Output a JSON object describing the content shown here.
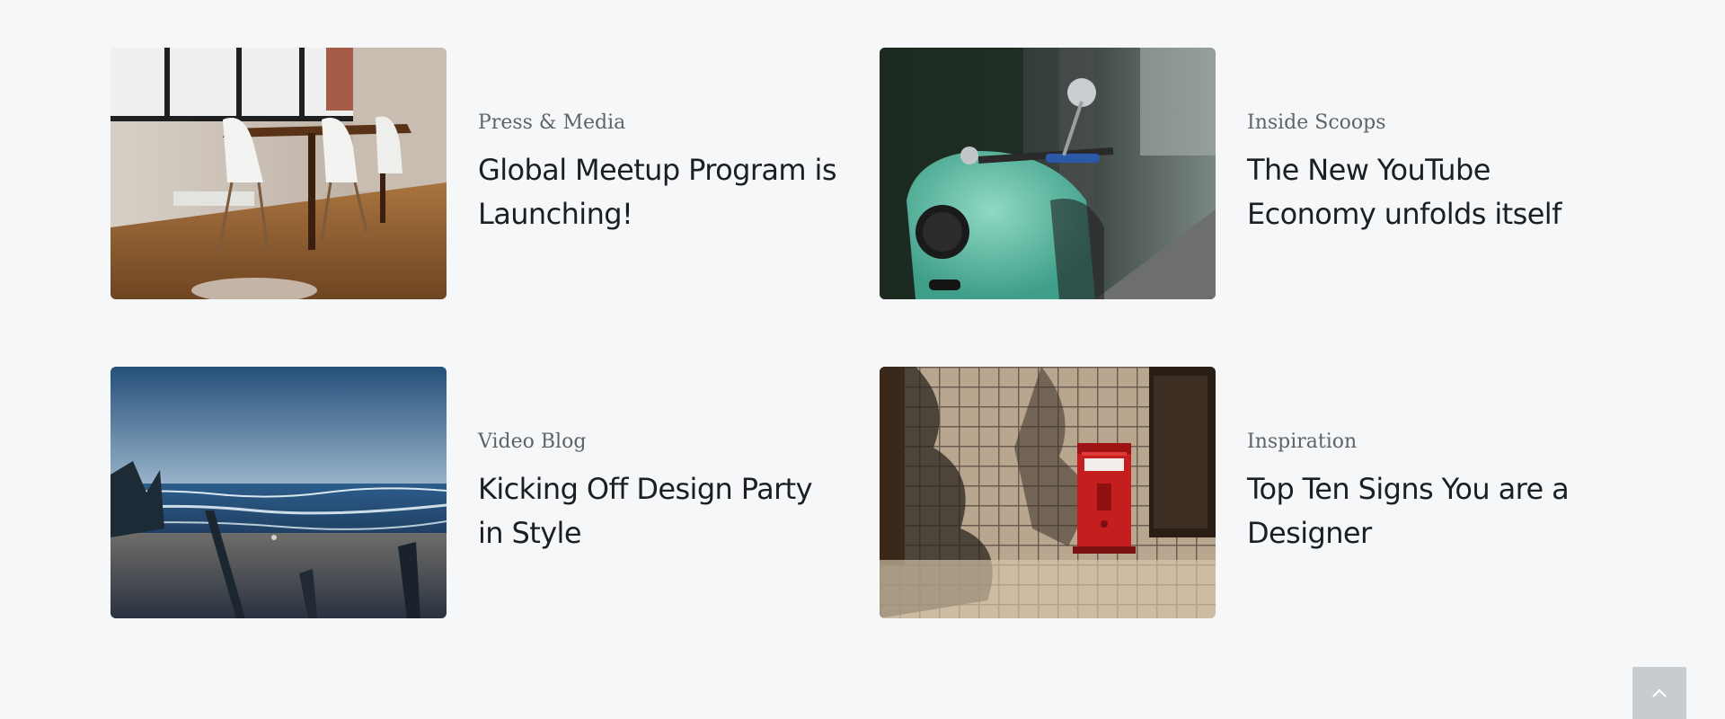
{
  "posts": [
    {
      "category": "Press & Media",
      "title": "Global Meetup Program is Launching!",
      "image_icon": "dining-room-image"
    },
    {
      "category": "Inside Scoops",
      "title": "The New YouTube Economy unfolds itself",
      "image_icon": "scooter-image"
    },
    {
      "category": "Video Blog",
      "title": "Kicking Off Design Party in Style",
      "image_icon": "beach-image"
    },
    {
      "category": "Inspiration",
      "title": "Top Ten Signs You are a Designer",
      "image_icon": "mailbox-wall-image"
    }
  ],
  "back_to_top": {
    "icon": "chevron-up-icon",
    "color": "#c8cccf"
  },
  "colors": {
    "background": "#f6f7f9",
    "category_text": "#5f6366",
    "title_text": "#1b1f22"
  }
}
